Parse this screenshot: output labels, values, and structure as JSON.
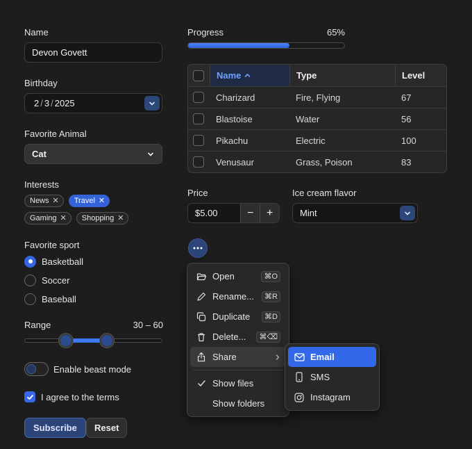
{
  "name": {
    "label": "Name",
    "value": "Devon Govett"
  },
  "birthday": {
    "label": "Birthday",
    "month": "2",
    "day": "3",
    "year": "2025",
    "sep": "/"
  },
  "animal": {
    "label": "Favorite Animal",
    "value": "Cat"
  },
  "interests": {
    "label": "Interests",
    "tags": [
      {
        "label": "News",
        "selected": false
      },
      {
        "label": "Travel",
        "selected": true
      },
      {
        "label": "Gaming",
        "selected": false
      },
      {
        "label": "Shopping",
        "selected": false
      }
    ]
  },
  "sport": {
    "label": "Favorite sport",
    "options": [
      {
        "label": "Basketball",
        "selected": true
      },
      {
        "label": "Soccer",
        "selected": false
      },
      {
        "label": "Baseball",
        "selected": false
      }
    ]
  },
  "range": {
    "label": "Range",
    "value_text": "30 – 60",
    "min": 30,
    "max": 60,
    "scale_min": 0,
    "scale_max": 100
  },
  "beast_mode": {
    "label": "Enable beast mode",
    "on": false
  },
  "terms": {
    "label": "I agree to the terms",
    "checked": true
  },
  "buttons": {
    "subscribe": "Subscribe",
    "reset": "Reset"
  },
  "progress": {
    "label": "Progress",
    "value_text": "65%",
    "value": 0.65
  },
  "table": {
    "columns": [
      "Name",
      "Type",
      "Level"
    ],
    "sort_indicator": "^",
    "rows": [
      {
        "name": "Charizard",
        "type": "Fire, Flying",
        "level": "67"
      },
      {
        "name": "Blastoise",
        "type": "Water",
        "level": "56"
      },
      {
        "name": "Pikachu",
        "type": "Electric",
        "level": "100"
      },
      {
        "name": "Venusaur",
        "type": "Grass, Poison",
        "level": "83"
      }
    ]
  },
  "price": {
    "label": "Price",
    "value": "$5.00",
    "minus": "−",
    "plus": "+"
  },
  "flavor": {
    "label": "Ice cream flavor",
    "value": "Mint"
  },
  "menu": {
    "items": [
      {
        "label": "Open",
        "shortcut": "⌘O",
        "icon": "folder-open-icon"
      },
      {
        "label": "Rename...",
        "shortcut": "⌘R",
        "icon": "pencil-icon"
      },
      {
        "label": "Duplicate",
        "shortcut": "⌘D",
        "icon": "copy-icon"
      },
      {
        "label": "Delete...",
        "shortcut": "⌘⌫",
        "icon": "trash-icon"
      },
      {
        "label": "Share",
        "icon": "share-icon"
      }
    ],
    "toggles": [
      {
        "label": "Show files",
        "checked": true
      },
      {
        "label": "Show folders",
        "checked": false
      }
    ]
  },
  "submenu": {
    "items": [
      {
        "label": "Email",
        "icon": "mail-icon"
      },
      {
        "label": "SMS",
        "icon": "phone-icon"
      },
      {
        "label": "Instagram",
        "icon": "instagram-icon"
      }
    ]
  },
  "colors": {
    "accent": "#3369e8",
    "background": "#1d1d1d"
  }
}
